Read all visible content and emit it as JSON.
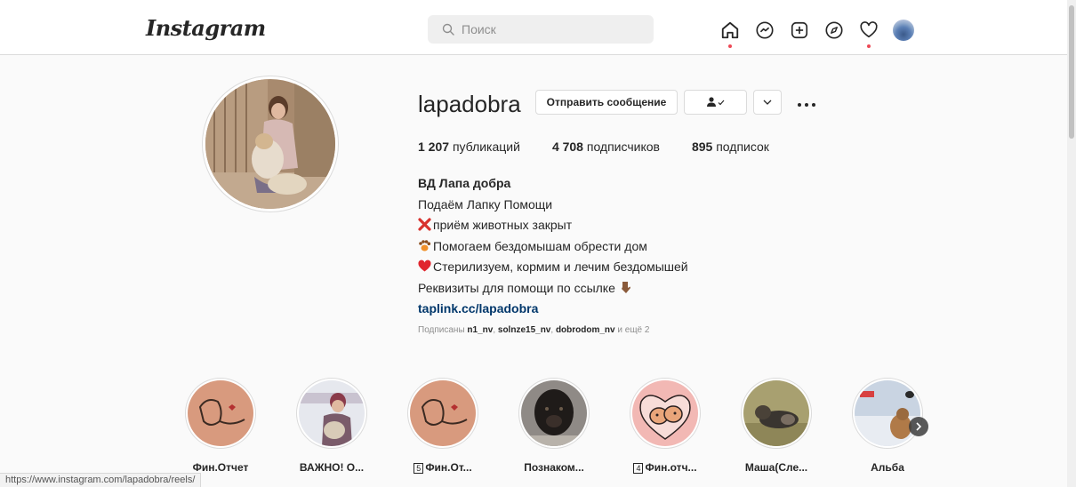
{
  "header": {
    "logo": "Instagram",
    "search_placeholder": "Поиск"
  },
  "profile": {
    "username": "lapadobra",
    "message_button": "Отправить сообщение",
    "stats": [
      {
        "count": "1 207",
        "label": "публикаций"
      },
      {
        "count": "4 708",
        "label": "подписчиков"
      },
      {
        "count": "895",
        "label": "подписок"
      }
    ],
    "bio": {
      "name": "ВД Лапа добра",
      "lines": [
        "Подаём Лапку Помощи",
        "приём животных закрыт",
        "Помогаем бездомышам обрести дом",
        "Стерилизуем, кормим и лечим бездомышей",
        "Реквизиты для помощи по ссылке"
      ],
      "link": "taplink.cc/lapadobra"
    },
    "followed_by": {
      "prefix": "Подписаны",
      "users": [
        "n1_nv",
        "solnze15_nv",
        "dobrodom_nv"
      ],
      "suffix": "и ещё 2"
    }
  },
  "highlights": [
    {
      "label": "Фин.Отчет",
      "badge": ""
    },
    {
      "label": "ВАЖНО! О...",
      "badge": ""
    },
    {
      "label": "Фин.От...",
      "badge": "5"
    },
    {
      "label": "Познаком...",
      "badge": ""
    },
    {
      "label": "Фин.отч...",
      "badge": "4"
    },
    {
      "label": "Маша(Сле...",
      "badge": ""
    },
    {
      "label": "Альба",
      "badge": ""
    }
  ],
  "status_url": "https://www.instagram.com/lapadobra/reels/",
  "colors": {
    "link": "#00376b",
    "notification_dot": "#ed4956",
    "secondary_text": "#8e8e8e",
    "border": "#dbdbdb"
  }
}
